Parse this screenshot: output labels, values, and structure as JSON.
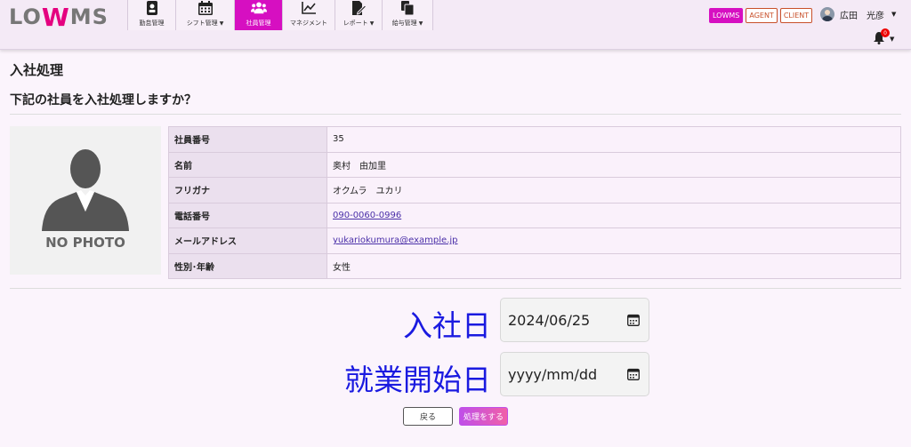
{
  "header": {
    "logo": {
      "pre": "LO",
      "mid": "W",
      "post": "MS"
    },
    "nav": [
      {
        "label": "勤怠管理",
        "icon": "id-card-icon",
        "caret": false,
        "active": false
      },
      {
        "label": "シフト管理",
        "icon": "calendar-icon",
        "caret": true,
        "active": false
      },
      {
        "label": "社員管理",
        "icon": "users-icon",
        "caret": false,
        "active": true
      },
      {
        "label": "マネジメント",
        "icon": "chart-line-icon",
        "caret": false,
        "active": false
      },
      {
        "label": "レポート",
        "icon": "report-edit-icon",
        "caret": true,
        "active": false
      },
      {
        "label": "給与管理",
        "icon": "documents-icon",
        "caret": true,
        "active": false
      }
    ],
    "badges": {
      "lowms": "LOWMS",
      "agent": "AGENT",
      "client": "CLIENT"
    },
    "user_name": "広田　光彦",
    "notification_count": "0"
  },
  "page": {
    "title": "入社処理",
    "question": "下記の社員を入社処理しますか？",
    "no_photo": "NO PHOTO"
  },
  "employee": {
    "rows": [
      {
        "key": "社員番号",
        "value": "35"
      },
      {
        "key": "名前",
        "value": "奥村　由加里"
      },
      {
        "key": "フリガナ",
        "value": "オクムラ　ユカリ"
      },
      {
        "key": "電話番号",
        "value": "090-0060-0996"
      },
      {
        "key": "メールアドレス",
        "value": "yukariokumura@example.jp"
      },
      {
        "key": "性別･年齢",
        "value": "女性"
      }
    ]
  },
  "form": {
    "join_date_label": "入社日",
    "join_date_value": "2024/06/25",
    "start_date_label": "就業開始日",
    "start_date_placeholder": "yyyy/mm/dd"
  },
  "buttons": {
    "back": "戻る",
    "submit": "処理をする"
  },
  "colors": {
    "accent": "#d60fc1",
    "form_label": "#1a1ae0",
    "link": "#4a2fa8"
  }
}
